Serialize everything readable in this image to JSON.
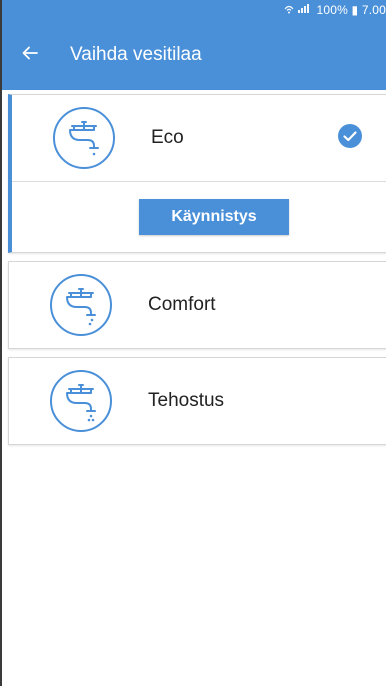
{
  "status_bar": {
    "signal_icons": "wifi-signal-battery-icons",
    "text": "100% ▮ 7.00"
  },
  "header": {
    "back_icon": "arrow-left-icon",
    "title": "Vaihda vesitilaa"
  },
  "modes": [
    {
      "label": "Eco",
      "selected": true,
      "icon": "faucet-icon"
    },
    {
      "label": "Comfort",
      "selected": false,
      "icon": "faucet-icon"
    },
    {
      "label": "Tehostus",
      "selected": false,
      "icon": "faucet-icon"
    }
  ],
  "start_button": {
    "label": "Käynnistys"
  },
  "colors": {
    "primary": "#4A90D9",
    "text": "#222222",
    "border": "#d6d6d6"
  }
}
